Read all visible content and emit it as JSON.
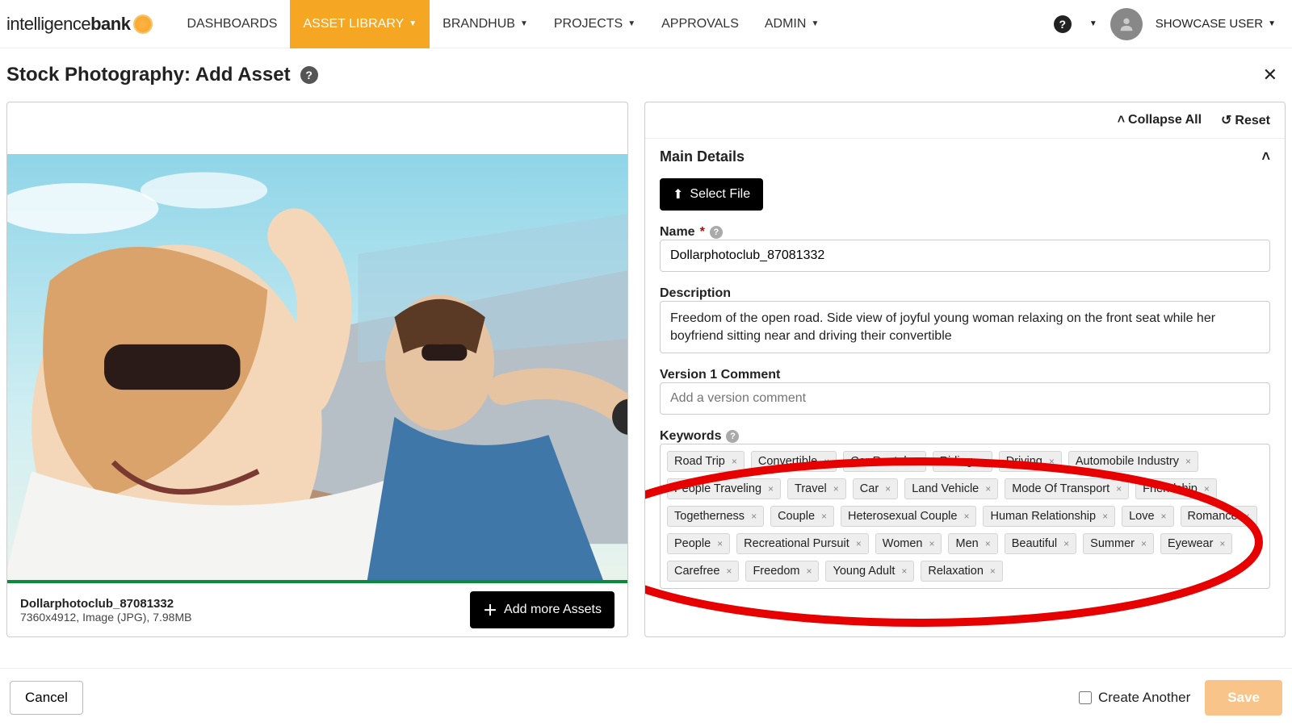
{
  "brand": {
    "part1": "intelligence",
    "part2": "bank"
  },
  "nav": {
    "items": [
      {
        "label": "DASHBOARDS",
        "active": false,
        "caret": false
      },
      {
        "label": "ASSET LIBRARY",
        "active": true,
        "caret": true
      },
      {
        "label": "BRANDHUB",
        "active": false,
        "caret": true
      },
      {
        "label": "PROJECTS",
        "active": false,
        "caret": true
      },
      {
        "label": "APPROVALS",
        "active": false,
        "caret": false
      },
      {
        "label": "ADMIN",
        "active": false,
        "caret": true
      }
    ]
  },
  "user": {
    "name": "SHOWCASE USER"
  },
  "page": {
    "title": "Stock Photography: Add Asset"
  },
  "panel": {
    "collapse": "Collapse All",
    "reset": "Reset",
    "section": "Main Details",
    "selectFile": "Select File"
  },
  "fields": {
    "nameLabel": "Name",
    "nameValue": "Dollarphotoclub_87081332",
    "descLabel": "Description",
    "descValue": "Freedom of the open road. Side view of joyful young woman relaxing on the front seat while her boyfriend sitting near and driving their convertible",
    "versionLabel": "Version 1 Comment",
    "versionPlaceholder": "Add a version comment",
    "keywordsLabel": "Keywords"
  },
  "keywords": [
    "Road Trip",
    "Convertible",
    "Car Rental",
    "Riding",
    "Driving",
    "Automobile Industry",
    "People Traveling",
    "Travel",
    "Car",
    "Land Vehicle",
    "Mode Of Transport",
    "Friendship",
    "Togetherness",
    "Couple",
    "Heterosexual Couple",
    "Human Relationship",
    "Love",
    "Romance",
    "People",
    "Recreational Pursuit",
    "Women",
    "Men",
    "Beautiful",
    "Summer",
    "Eyewear",
    "Carefree",
    "Freedom",
    "Young Adult",
    "Relaxation"
  ],
  "file": {
    "name": "Dollarphotoclub_87081332",
    "meta": "7360x4912, Image (JPG), 7.98MB",
    "addMore": "Add more Assets"
  },
  "footer": {
    "cancel": "Cancel",
    "createAnother": "Create Another",
    "save": "Save"
  }
}
